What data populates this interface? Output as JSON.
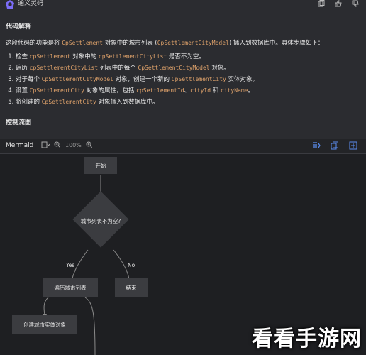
{
  "header": {
    "title": "通义灵码"
  },
  "content": {
    "section1_title": "代码解释",
    "intro": {
      "prefix": "这段代码的功能是将 ",
      "code1": "CpSettlement",
      "mid1": " 对象中的城市列表 (",
      "code2": "CpSettlementCityModel",
      "suffix": ") 插入到数据库中。具体步骤如下："
    },
    "steps": [
      {
        "pre": "检查 ",
        "code": "cpSettlement",
        "mid": " 对象中的 ",
        "code2": "cpSettlementCityList",
        "post": " 是否不为空。"
      },
      {
        "pre": "遍历 ",
        "code": "cpSettlementCityList",
        "mid": " 列表中的每个 ",
        "code2": "CpSettlementCityModel",
        "post": " 对象。"
      },
      {
        "pre": "对于每个 ",
        "code": "CpSettlementCityModel",
        "mid": " 对象，创建一个新的 ",
        "code2": "CpSettlementCity",
        "post": " 实体对象。"
      },
      {
        "pre": "设置 ",
        "code": "CpSettlementCity",
        "mid": " 对象的属性，包括 ",
        "code2": "cpSettlementId",
        "mid2": "、",
        "code3": "cityId",
        "mid3": " 和 ",
        "code4": "cityName",
        "post": "。"
      },
      {
        "pre": "将创建的 ",
        "code": "CpSettlementCity",
        "mid": " 对象插入到数据库中。",
        "code2": "",
        "post": ""
      }
    ],
    "section2_title": "控制流图"
  },
  "mermaid": {
    "label": "Mermaid",
    "zoom": "100%",
    "nodes": {
      "start": "开始",
      "decision": "城市列表不为空?",
      "loop": "遍历城市列表",
      "end": "结束",
      "create": "创建城市实体对象"
    },
    "edges": {
      "yes": "Yes",
      "no": "No"
    }
  },
  "watermark": "看看手游网"
}
